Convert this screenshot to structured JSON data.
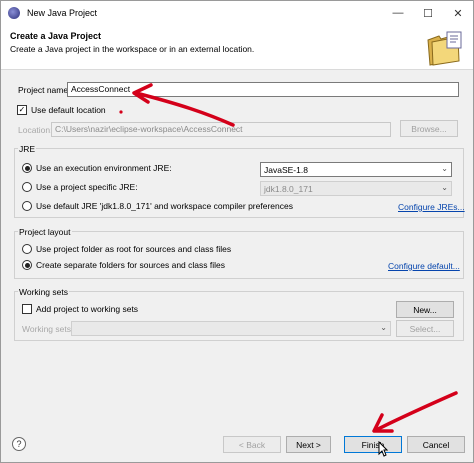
{
  "window": {
    "title": "New Java Project",
    "minimize_glyph": "—",
    "maximize_glyph": "☐",
    "close_glyph": "✕"
  },
  "header": {
    "title": "Create a Java Project",
    "description": "Create a Java project in the workspace or in an external location."
  },
  "project": {
    "name_label": "Project name:",
    "name_value": "AccessConnect",
    "use_default_location_label": "Use default location",
    "use_default_location_checked": true,
    "location_label": "Location:",
    "location_value": "C:\\Users\\nazir\\eclipse-workspace\\AccessConnect",
    "browse_label": "Browse..."
  },
  "jre": {
    "group_label": "JRE",
    "option_execution_env_label": "Use an execution environment JRE:",
    "option_execution_env_value": "JavaSE-1.8",
    "option_project_specific_label": "Use a project specific JRE:",
    "option_project_specific_value": "jdk1.8.0_171",
    "option_default_label": "Use default JRE 'jdk1.8.0_171' and workspace compiler preferences",
    "configure_link": "Configure JREs...",
    "selected": "execution_env"
  },
  "layout": {
    "group_label": "Project layout",
    "option_root_label": "Use project folder as root for sources and class files",
    "option_separate_label": "Create separate folders for sources and class files",
    "configure_link": "Configure default...",
    "selected": "separate"
  },
  "working_sets": {
    "group_label": "Working sets",
    "add_label": "Add project to working sets",
    "add_checked": false,
    "new_label": "New...",
    "working_sets_label": "Working sets:",
    "select_label": "Select..."
  },
  "footer": {
    "help_glyph": "?",
    "back_label": "< Back",
    "next_label": "Next >",
    "finish_label": "Finish",
    "cancel_label": "Cancel"
  },
  "colors": {
    "annotation_arrow": "#d4001a",
    "link": "#0645ad",
    "default_button_border": "#0078d7"
  }
}
